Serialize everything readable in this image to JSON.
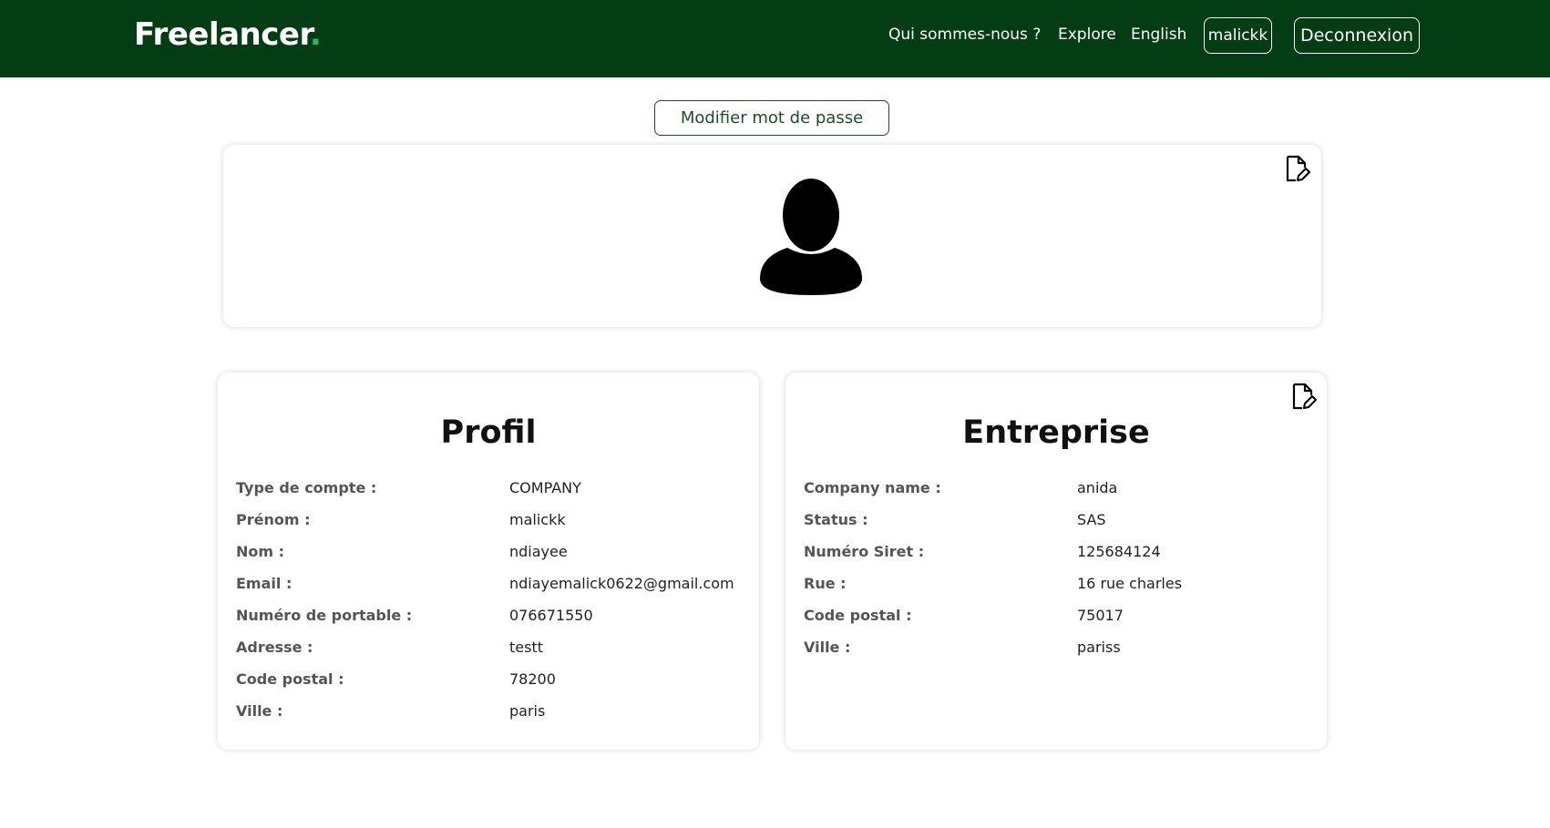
{
  "header": {
    "logo_text": "Freelancer",
    "logo_dot": ".",
    "nav": {
      "about": "Qui sommes-nous ?",
      "explore": "Explore",
      "language": "English",
      "user": "malickk",
      "logout": "Deconnexion"
    }
  },
  "password_button": "Modifier mot de passe",
  "avatar_card": {
    "avatar_icon": "user-silhouette-icon",
    "edit_icon": "file-edit-icon"
  },
  "profil": {
    "title": "Profil",
    "rows": [
      {
        "label": "Type de compte :",
        "value": "COMPANY"
      },
      {
        "label": "Prénom :",
        "value": "malickk"
      },
      {
        "label": "Nom :",
        "value": "ndiayee"
      },
      {
        "label": "Email :",
        "value": "ndiayemalick0622@gmail.com"
      },
      {
        "label": "Numéro de portable :",
        "value": "076671550"
      },
      {
        "label": "Adresse :",
        "value": "testt"
      },
      {
        "label": "Code postal :",
        "value": "78200"
      },
      {
        "label": "Ville :",
        "value": "paris"
      }
    ]
  },
  "entreprise": {
    "title": "Entreprise",
    "edit_icon": "file-edit-icon",
    "rows": [
      {
        "label": "Company name :",
        "value": "anida"
      },
      {
        "label": "Status :",
        "value": "SAS"
      },
      {
        "label": "Numéro Siret :",
        "value": "125684124"
      },
      {
        "label": "Rue :",
        "value": "16 rue charles"
      },
      {
        "label": "Code postal :",
        "value": "75017"
      },
      {
        "label": "Ville :",
        "value": "pariss"
      }
    ]
  },
  "colors": {
    "header_bg": "#033d14",
    "accent_dot": "#1fc35a",
    "button_text": "#1d4d2a"
  }
}
